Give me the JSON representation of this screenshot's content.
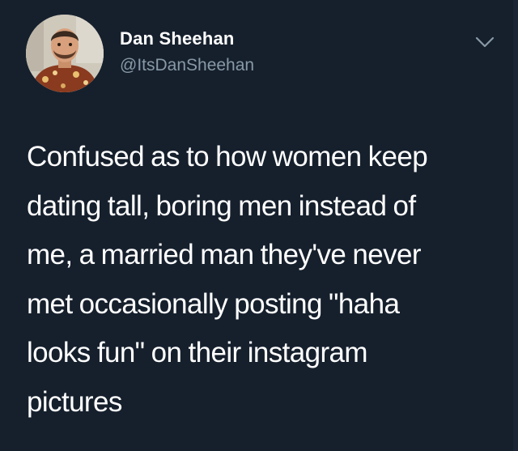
{
  "author": {
    "display_name": "Dan Sheehan",
    "handle": "@ItsDanSheehan",
    "avatar_icon": "profile-photo"
  },
  "menu": {
    "icon": "chevron-down-icon"
  },
  "tweet": {
    "lines": [
      "Confused as to how women keep",
      "dating tall, boring men instead of",
      "me, a married man they've never",
      "met occasionally posting \"haha",
      "looks fun\" on their instagram",
      "pictures"
    ]
  },
  "colors": {
    "background": "#16202d",
    "name": "#ffffff",
    "handle": "#8899a6",
    "text": "#ffffff"
  }
}
